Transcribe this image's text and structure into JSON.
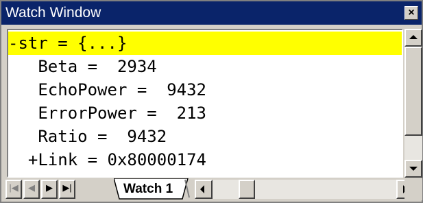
{
  "window": {
    "title": "Watch Window",
    "close_glyph": "×"
  },
  "watch": {
    "rows": [
      {
        "text": "-str = {...}",
        "selected": true
      },
      {
        "text": "   Beta =  2934",
        "selected": false
      },
      {
        "text": "   EchoPower =  9432",
        "selected": false
      },
      {
        "text": "   ErrorPower =  213",
        "selected": false
      },
      {
        "text": "   Ratio =  9432",
        "selected": false
      },
      {
        "text": "  +Link = 0x80000174",
        "selected": false
      }
    ]
  },
  "tabs": {
    "active_label": "Watch 1"
  },
  "icons": {
    "close": "close-icon",
    "scroll_up": "arrow-up-icon",
    "scroll_down": "arrow-down-icon",
    "first": "first-page-icon",
    "prev": "previous-page-icon",
    "next": "next-page-icon",
    "last": "last-page-icon"
  },
  "colors": {
    "selection": "#ffff00",
    "titlebar": "#0a246a",
    "face": "#d4d0c8"
  }
}
